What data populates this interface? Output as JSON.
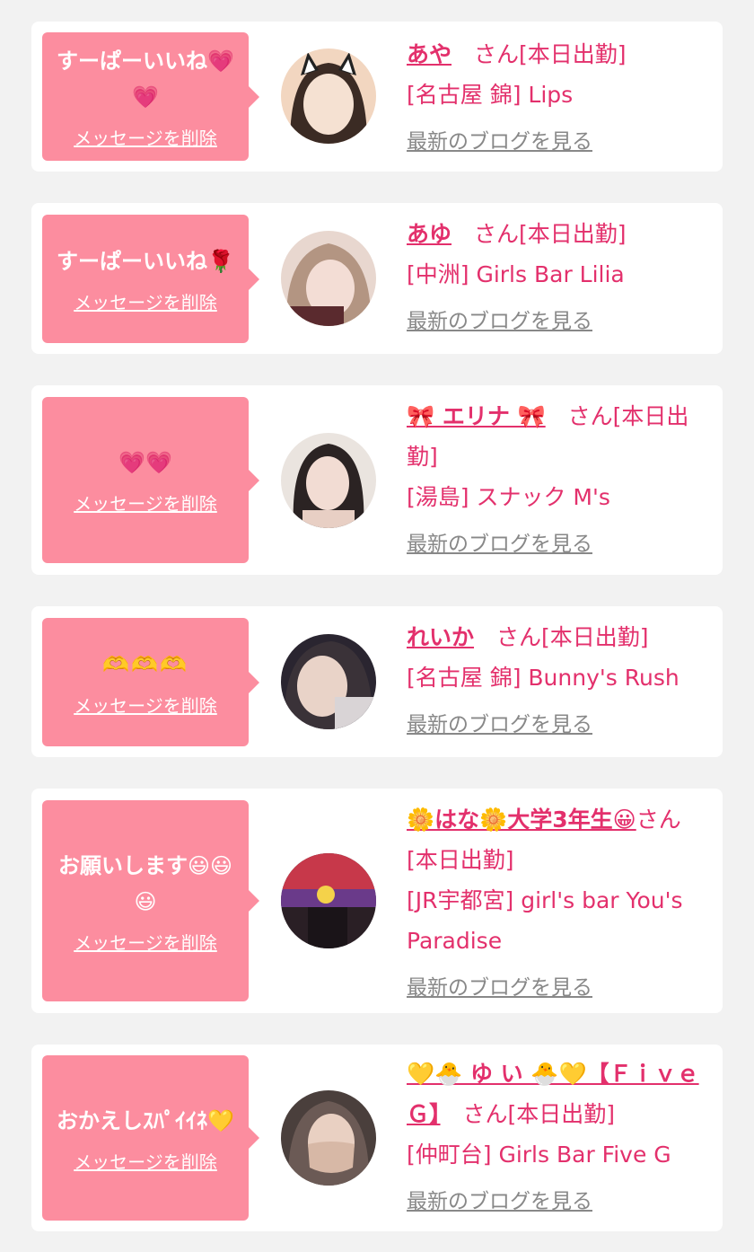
{
  "items": [
    {
      "message": "すーぱーいいね💗💗",
      "delete_label": "メッセージを削除",
      "name": "あや",
      "suffix": "　さん[本日出勤]",
      "store": "[名古屋 錦] Lips",
      "blog_label": "最新のブログを見る",
      "avatar_colors": [
        "#f2d6c0",
        "#3b2b24",
        "#f5e1d2"
      ]
    },
    {
      "message": "すーぱーいいね🌹",
      "delete_label": "メッセージを削除",
      "name": "あゆ",
      "suffix": "　さん[本日出勤]",
      "store": "[中洲] Girls Bar Lilia",
      "blog_label": "最新のブログを見る",
      "avatar_colors": [
        "#e8d7cf",
        "#b39582",
        "#f3ddd5"
      ]
    },
    {
      "message": "💗💗",
      "delete_label": "メッセージを削除",
      "name": "🎀 エリナ 🎀",
      "suffix": "　さん[本日出勤]",
      "store": "[湯島] スナック M's",
      "blog_label": "最新のブログを見る",
      "avatar_colors": [
        "#eae4df",
        "#2b2323",
        "#f2dcd3"
      ]
    },
    {
      "message": "🫶🫶🫶",
      "delete_label": "メッセージを削除",
      "name": "れいか",
      "suffix": "　さん[本日出勤]",
      "store": "[名古屋 錦] Bunny's Rush",
      "blog_label": "最新のブログを見る",
      "avatar_colors": [
        "#2a2530",
        "#3a3238",
        "#e9d3c8"
      ]
    },
    {
      "message": "お願いします😃😃😃",
      "delete_label": "メッセージを削除",
      "name": "🌼はな🌼大学3年生😀",
      "suffix": "さん[本日出勤]",
      "store": "[JR宇都宮] girl's bar You's Paradise",
      "blog_label": "最新のブログを見る",
      "avatar_colors": [
        "#2a1f25",
        "#c7384a",
        "#f4d24a"
      ]
    },
    {
      "message": "おかえしｽﾊﾟｲｲﾈ💛",
      "delete_label": "メッセージを削除",
      "name": "💛🐣 ゆ い 🐣💛【Ｆｉｖｅ Ｇ】",
      "suffix": "　さん[本日出勤]",
      "store": "[仲町台] Girls Bar Five G",
      "blog_label": "最新のブログを見る",
      "avatar_colors": [
        "#4a3f3c",
        "#d7b8a6",
        "#6b5a55"
      ]
    }
  ]
}
